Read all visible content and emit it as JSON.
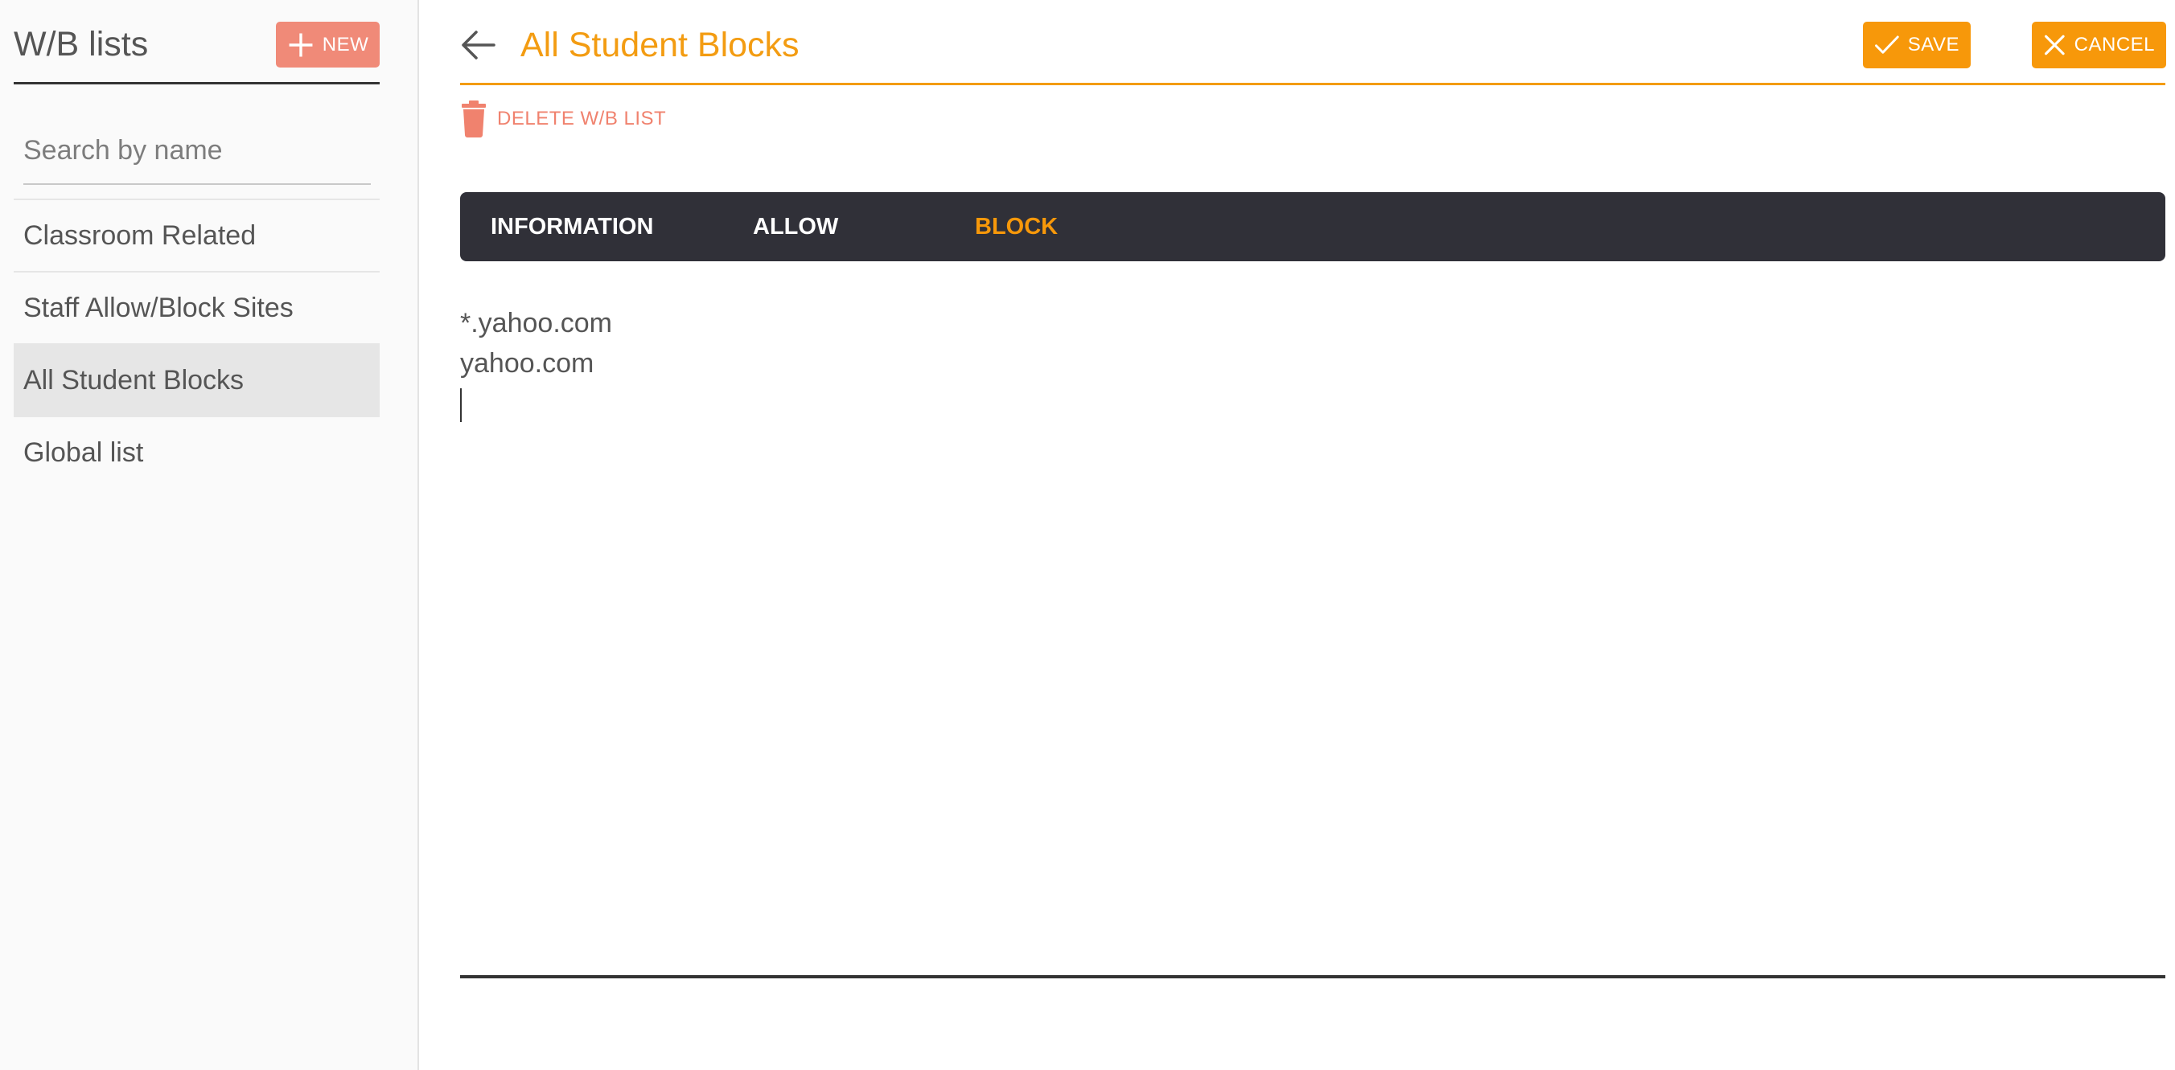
{
  "sidebar": {
    "title": "W/B lists",
    "new_label": "NEW",
    "search_placeholder": "Search by name",
    "items": [
      {
        "label": "Classroom Related"
      },
      {
        "label": "Staff Allow/Block Sites"
      },
      {
        "label": "All Student Blocks"
      },
      {
        "label": "Global list"
      }
    ],
    "selected": "All Student Blocks"
  },
  "header": {
    "title": "All Student Blocks",
    "save_label": "SAVE",
    "cancel_label": "CANCEL",
    "delete_label": "DELETE W/B LIST"
  },
  "tabs": [
    {
      "label": "INFORMATION"
    },
    {
      "label": "ALLOW"
    },
    {
      "label": "BLOCK"
    }
  ],
  "active_tab": "BLOCK",
  "editor": {
    "lines": [
      "*.yahoo.com",
      "yahoo.com"
    ]
  },
  "colors": {
    "accent": "#f7980a",
    "delete": "#f0826e",
    "tabbar": "#303038"
  }
}
